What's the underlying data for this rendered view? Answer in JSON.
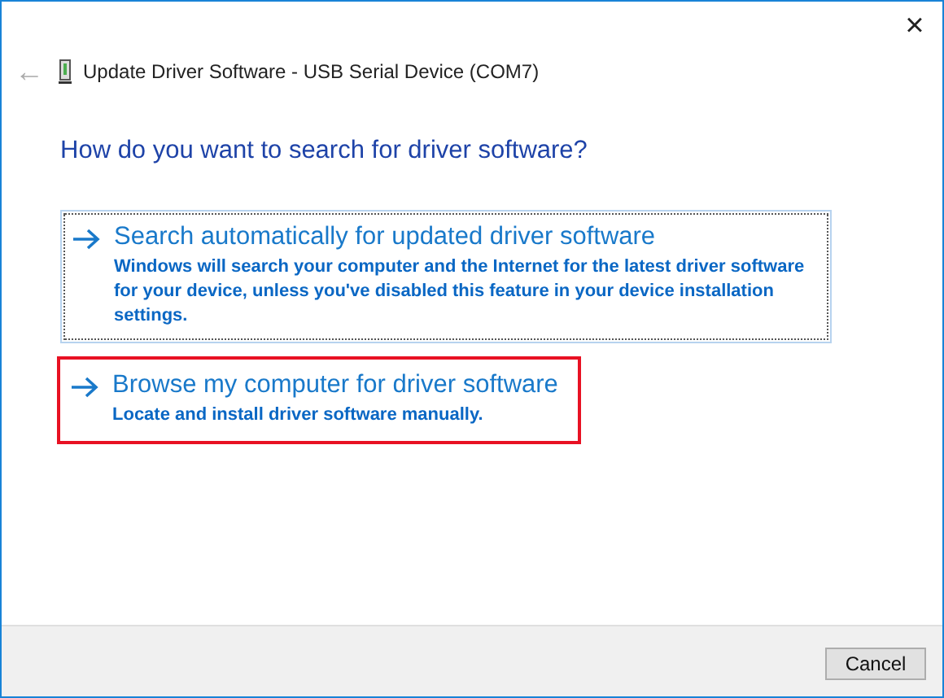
{
  "window": {
    "title": "Update Driver Software - USB Serial Device (COM7)",
    "close": "×",
    "back": "←"
  },
  "heading": "How do you want to search for driver software?",
  "options": [
    {
      "title": "Search automatically for updated driver software",
      "description": "Windows will search your computer and the Internet for the latest driver software for your device, unless you've disabled this feature in your device installation settings.",
      "focused": true,
      "highlighted": false
    },
    {
      "title": "Browse my computer for driver software",
      "description": "Locate and install driver software manually.",
      "focused": false,
      "highlighted": true
    }
  ],
  "buttons": [
    "Cancel"
  ]
}
